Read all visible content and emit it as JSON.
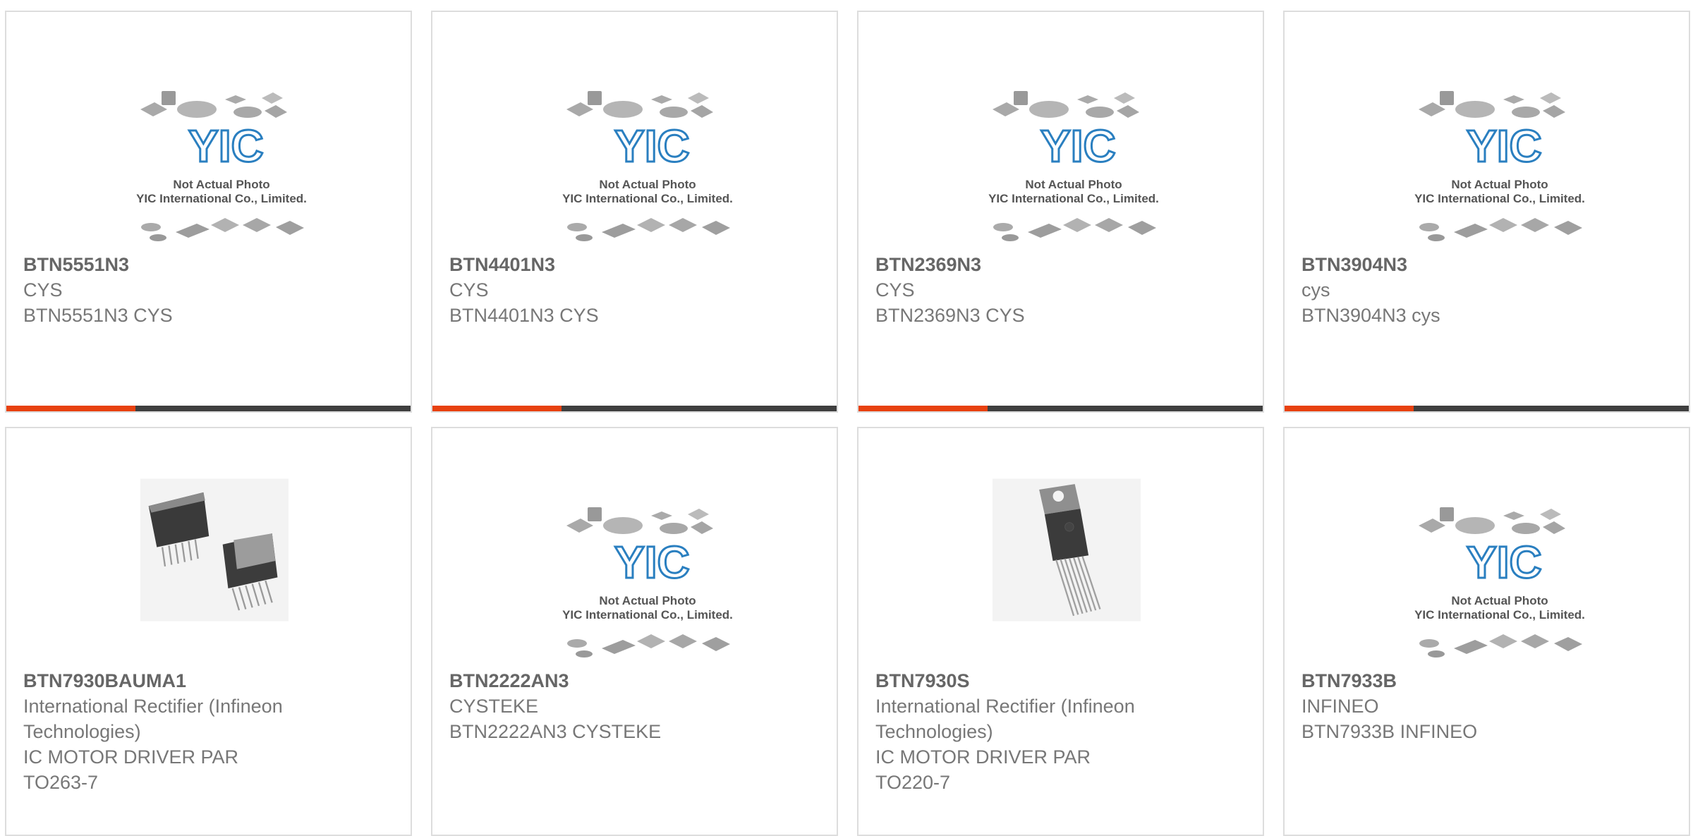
{
  "colors": {
    "accent": "#e8410f",
    "bar": "#3f3f3f",
    "border": "#dddddd",
    "logo": "#2a7fc0"
  },
  "placeholder": {
    "line1": "Not Actual Photo",
    "line2": "YIC International Co., Limited.",
    "logo_text": "YIC"
  },
  "products": [
    {
      "part": "BTN5551N3",
      "maker": "CYS",
      "desc": [
        "BTN5551N3 CYS"
      ],
      "image": "placeholder"
    },
    {
      "part": "BTN4401N3",
      "maker": "CYS",
      "desc": [
        "BTN4401N3 CYS"
      ],
      "image": "placeholder"
    },
    {
      "part": "BTN2369N3",
      "maker": "CYS",
      "desc": [
        "BTN2369N3 CYS"
      ],
      "image": "placeholder"
    },
    {
      "part": "BTN3904N3",
      "maker": "cys",
      "desc": [
        "BTN3904N3 cys"
      ],
      "image": "placeholder"
    },
    {
      "part": "BTN7930BAUMA1",
      "maker": "International Rectifier (Infineon Technologies)",
      "desc": [
        "IC MOTOR DRIVER PAR",
        "TO263-7"
      ],
      "image": "to263-icon"
    },
    {
      "part": "BTN2222AN3",
      "maker": "CYSTEKE",
      "desc": [
        "BTN2222AN3 CYSTEKE"
      ],
      "image": "placeholder"
    },
    {
      "part": "BTN7930S",
      "maker": "International Rectifier (Infineon Technologies)",
      "desc": [
        "IC MOTOR DRIVER PAR",
        "TO220-7"
      ],
      "image": "to220-icon"
    },
    {
      "part": "BTN7933B",
      "maker": "INFINEO",
      "desc": [
        "BTN7933B INFINEO"
      ],
      "image": "placeholder"
    }
  ]
}
